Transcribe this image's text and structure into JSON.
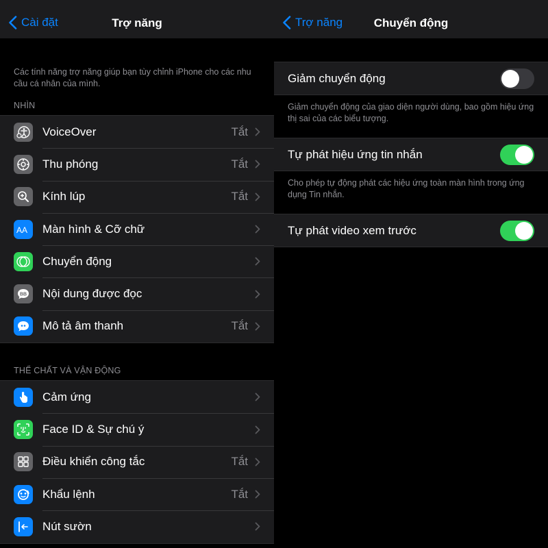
{
  "left": {
    "back_label": "Cài đặt",
    "title": "Trợ năng",
    "description": "Các tính năng trợ năng giúp bạn tùy chỉnh iPhone cho các nhu cầu cá nhân của mình.",
    "section_vision": {
      "header": "NHÌN",
      "items": [
        {
          "label": "VoiceOver",
          "value": "Tắt",
          "icon": "voiceover-icon"
        },
        {
          "label": "Thu phóng",
          "value": "Tắt",
          "icon": "zoom-icon"
        },
        {
          "label": "Kính lúp",
          "value": "Tắt",
          "icon": "magnifier-icon"
        },
        {
          "label": "Màn hình & Cỡ chữ",
          "value": "",
          "icon": "text-size-icon"
        },
        {
          "label": "Chuyển động",
          "value": "",
          "icon": "motion-icon"
        },
        {
          "label": "Nội dung được đọc",
          "value": "",
          "icon": "spoken-content-icon"
        },
        {
          "label": "Mô tả âm thanh",
          "value": "Tắt",
          "icon": "audio-description-icon"
        }
      ]
    },
    "section_physical": {
      "header": "THỂ CHẤT VÀ VẬN ĐỘNG",
      "items": [
        {
          "label": "Cảm ứng",
          "value": "",
          "icon": "touch-icon"
        },
        {
          "label": "Face ID & Sự chú ý",
          "value": "",
          "icon": "face-id-icon"
        },
        {
          "label": "Điều khiển công tắc",
          "value": "Tắt",
          "icon": "switch-control-icon"
        },
        {
          "label": "Khẩu lệnh",
          "value": "Tắt",
          "icon": "voice-control-icon"
        },
        {
          "label": "Nút sườn",
          "value": "",
          "icon": "side-button-icon"
        }
      ]
    }
  },
  "right": {
    "back_label": "Trợ năng",
    "title": "Chuyển động",
    "settings": [
      {
        "label": "Giảm chuyển động",
        "on": false,
        "footer": "Giảm chuyển động của giao diện người dùng, bao gồm hiệu ứng thị sai của các biểu tượng."
      },
      {
        "label": "Tự phát hiệu ứng tin nhắn",
        "on": true,
        "footer": "Cho phép tự động phát các hiệu ứng toàn màn hình trong ứng dụng Tin nhắn."
      },
      {
        "label": "Tự phát video xem trước",
        "on": true,
        "footer": ""
      }
    ]
  },
  "colors": {
    "accent": "#0a84ff",
    "toggle_on": "#30d158",
    "toggle_off": "#39393d",
    "cell_bg": "#1c1c1e",
    "secondary_text": "#8e8e93"
  },
  "icons": {
    "back": "chevron-left-icon",
    "disclosure": "chevron-right-icon"
  }
}
